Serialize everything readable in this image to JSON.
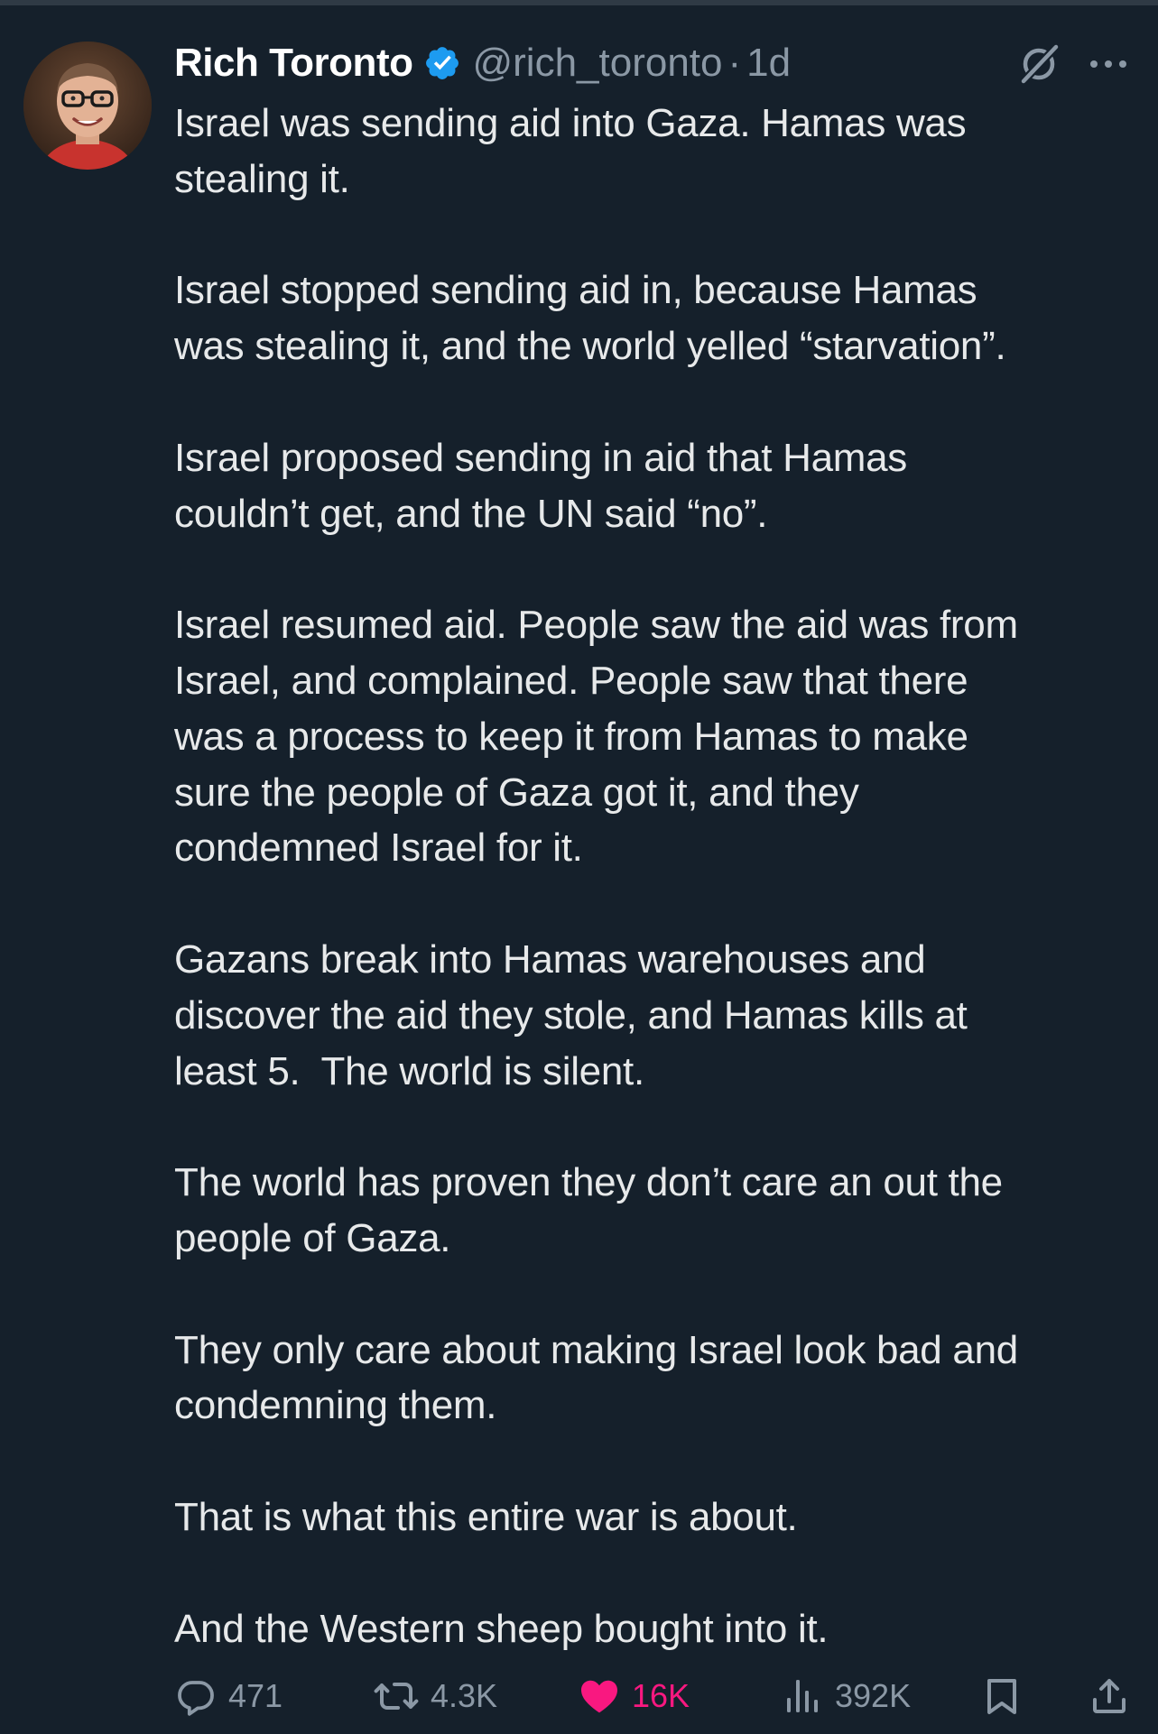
{
  "tweet": {
    "display_name": "Rich Toronto",
    "handle": "@rich_toronto",
    "separator": "·",
    "time": "1d",
    "paragraphs": [
      "Israel was sending aid into Gaza. Hamas was\nstealing it.",
      "Israel stopped sending aid in, because Hamas\nwas stealing it, and the world yelled “starvation”.",
      "Israel proposed sending in aid that Hamas\ncouldn’t get, and the UN said “no”.",
      "Israel resumed aid. People saw the aid was from\nIsrael, and complained. People saw that there\nwas a process to keep it from Hamas to make\nsure the people of Gaza got it, and they\ncondemned Israel for it.",
      "Gazans break into Hamas warehouses and\ndiscover the aid they stole, and Hamas kills at\nleast 5.  The world is silent.",
      "The world has proven they don’t care an out the\npeople of Gaza.",
      "They only care about making Israel look bad and\ncondemning them.",
      "That is what this entire war is about.",
      "And the Western sheep bought into it."
    ]
  },
  "actions": {
    "replies": "471",
    "reposts": "4.3K",
    "likes": "16K",
    "views": "392K"
  },
  "icons": {
    "verified": "verified-badge-icon",
    "grok": "grok-icon",
    "more": "more-icon",
    "reply": "reply-icon",
    "repost": "repost-icon",
    "like": "heart-icon",
    "views": "views-icon",
    "bookmark": "bookmark-icon",
    "share": "share-icon"
  },
  "colors": {
    "background": "#15202b",
    "text": "#e7e9ea",
    "secondary": "#8b98a5",
    "verified": "#1d9bf0",
    "like": "#f91880"
  }
}
